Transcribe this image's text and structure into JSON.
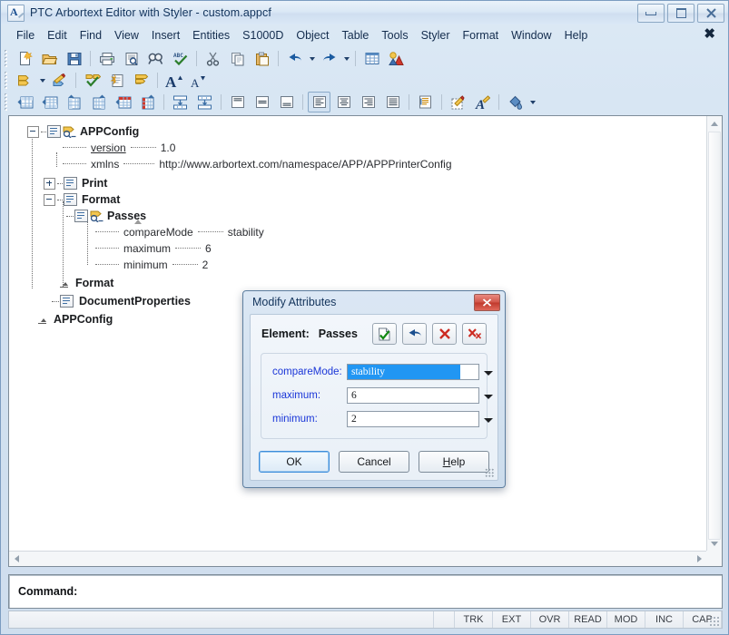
{
  "window": {
    "title": "PTC Arbortext Editor with Styler - custom.appcf",
    "icon": "arbortext-app-icon",
    "controls": {
      "minimize": "minimize-button",
      "maximize": "maximize-button",
      "close": "close-button"
    }
  },
  "menubar": {
    "items": [
      "File",
      "Edit",
      "Find",
      "View",
      "Insert",
      "Entities",
      "S1000D",
      "Object",
      "Table",
      "Tools",
      "Styler",
      "Format",
      "Window",
      "Help"
    ],
    "close_document_label": "✖"
  },
  "toolbars": {
    "row1": [
      "new-document-icon",
      "open-folder-icon",
      "save-icon",
      "sep",
      "print-icon",
      "print-preview-icon",
      "find-icon",
      "spell-check-icon",
      "sep",
      "cut-icon",
      "copy-icon",
      "paste-icon",
      "sep",
      "undo-icon",
      "undo-dropdown-arrow",
      "redo-icon",
      "redo-dropdown-arrow",
      "sep",
      "insert-table-icon",
      "insert-graphic-icon"
    ],
    "row2": [
      "insert-tag-icon",
      "insert-tag-dropdown-arrow",
      "modify-tag-icon",
      "sep",
      "check-completeness-icon",
      "document-properties-icon",
      "list-format-icon",
      "sep",
      "increase-font-size-icon",
      "decrease-font-size-icon"
    ],
    "row3": [
      "insert-row-above-icon",
      "insert-row-below-icon",
      "insert-column-left-icon",
      "insert-column-right-icon",
      "delete-row-icon",
      "delete-column-icon",
      "sep",
      "merge-cells-icon",
      "split-cells-icon",
      "sep",
      "align-top-icon",
      "align-middle-icon",
      "align-bottom-icon",
      "sep",
      "align-left-icon",
      "align-center-icon",
      "align-right-icon",
      "align-justify-icon",
      "sep",
      "paragraph-format-icon",
      "sep",
      "highlight-icon",
      "font-style-icon",
      "sep",
      "fill-color-icon",
      "fill-color-dropdown-arrow"
    ]
  },
  "tree": {
    "nodes": [
      {
        "label": "APPConfig",
        "type": "element",
        "expander": "minus",
        "indent": 0,
        "tag_icon": true
      },
      {
        "label": "version",
        "type": "attribute",
        "value": "1.0",
        "indent": 1,
        "underline": true
      },
      {
        "label": "xmlns",
        "type": "attribute",
        "value": "http://www.arbortext.com/namespace/APP/APPPrinterConfig",
        "indent": 1,
        "underline": false
      },
      {
        "label": "Print",
        "type": "element",
        "expander": "plus",
        "indent": 1,
        "tag_icon": false
      },
      {
        "label": "Format",
        "type": "element",
        "expander": "minus",
        "indent": 1,
        "tag_icon": false
      },
      {
        "label": "Passes",
        "type": "element",
        "expander": "none",
        "indent": 2,
        "tag_icon": true,
        "selected_caret": true
      },
      {
        "label": "compareMode",
        "type": "attribute",
        "value": "stability",
        "indent": 3,
        "underline": false
      },
      {
        "label": "maximum",
        "type": "attribute",
        "value": "6",
        "indent": 3,
        "underline": false
      },
      {
        "label": "minimum",
        "type": "attribute",
        "value": "2",
        "indent": 3,
        "underline": false
      },
      {
        "label": "Format",
        "type": "end-tag",
        "indent": 2
      },
      {
        "label": "DocumentProperties",
        "type": "element",
        "expander": "none",
        "indent": 1,
        "tag_icon": false
      },
      {
        "label": "APPConfig",
        "type": "end-tag",
        "indent": 0
      }
    ]
  },
  "dialog": {
    "title": "Modify Attributes",
    "close_label": "✕",
    "element_label": "Element:",
    "element_name": "Passes",
    "toolbar_buttons": [
      {
        "name": "apply-attribute-button",
        "icon": "page-checkmark-icon"
      },
      {
        "name": "undo-attribute-button",
        "icon": "undo-arrow-icon"
      },
      {
        "name": "delete-attribute-button",
        "icon": "red-x-icon"
      },
      {
        "name": "delete-all-attributes-button",
        "icon": "red-xx-icon"
      }
    ],
    "attributes": [
      {
        "label": "compareMode:",
        "value": "stability",
        "selected": true
      },
      {
        "label": "maximum:",
        "value": "6",
        "selected": false
      },
      {
        "label": "minimum:",
        "value": "2",
        "selected": false
      }
    ],
    "buttons": {
      "ok": "OK",
      "cancel": "Cancel",
      "help": "Help",
      "help_mnemonic": "H",
      "help_rest": "elp"
    },
    "colors": {
      "label": "#1a36d8",
      "selection": "#2196f3",
      "title_text": "#12335b"
    }
  },
  "command_bar": {
    "label": "Command:",
    "value": ""
  },
  "status_bar": {
    "cells": [
      "TRK",
      "EXT",
      "OVR",
      "READ",
      "MOD",
      "INC",
      "CAP"
    ]
  }
}
